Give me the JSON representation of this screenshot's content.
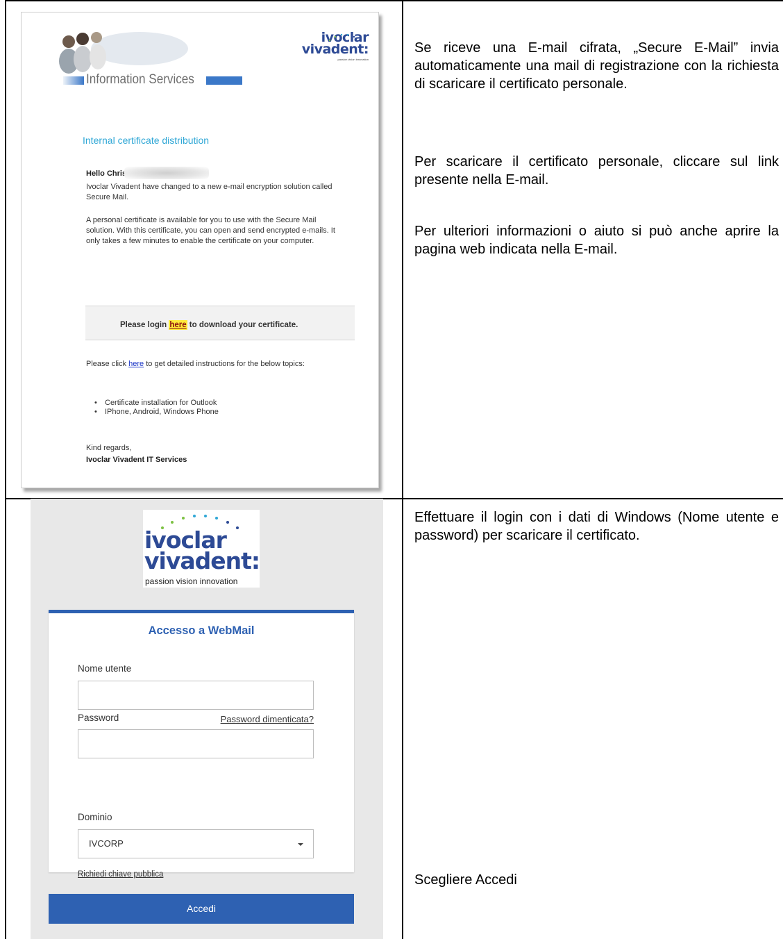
{
  "email": {
    "banner_title": "Information Services",
    "brand_line1": "ivoclar",
    "brand_line2": "vivadent:",
    "brand_tagline": "passion vision innovation",
    "section_title": "Internal certificate distribution",
    "greeting": "Hello Chris",
    "intro": "Ivoclar Vivadent have changed to a new e-mail encryption solution called Secure Mail.",
    "body": "A personal certificate is available for you to use with the Secure Mail solution. With this certificate, you can open and send encrypted e-mails. It only takes a few minutes to enable the certificate on your computer.",
    "login_prefix": "Please login ",
    "login_link": "here",
    "login_suffix": " to download your certificate.",
    "instructions_prefix": "Please click ",
    "instructions_link": "here",
    "instructions_suffix": " to get detailed instructions for the below topics:",
    "topics": [
      "Certificate installation for Outlook",
      "IPhone, Android, Windows Phone"
    ],
    "closing": "Kind regards,",
    "signature": "Ivoclar Vivadent IT Services"
  },
  "instructions": {
    "para1": "Se riceve una E-mail cifrata, „Secure E-Mail” invia automaticamente una mail di registrazione con la richiesta di scaricare il certificato personale.",
    "para2": "Per scaricare il certificato personale, cliccare sul link presente nella E-mail.",
    "para3": "Per ulteriori informazioni o aiuto si può anche aprire la pagina web indicata nella E-mail.",
    "para4": "Effettuare il login con i dati di Windows (Nome utente e password) per scaricare il certificato.",
    "para5": "Scegliere Accedi"
  },
  "login": {
    "brand_line1": "ivoclar",
    "brand_line2": "vivadent:",
    "brand_tagline": "passion vision innovation",
    "title": "Accesso a WebMail",
    "username_label": "Nome utente",
    "username_value": "",
    "password_label": "Password",
    "password_value": "",
    "forgot_link": "Password dimenticata?",
    "domain_label": "Dominio",
    "domain_value": "IVCORP",
    "public_key_link": "Richiedi chiave pubblica",
    "submit_label": "Accedi",
    "accent_color": "#2e61b2"
  }
}
